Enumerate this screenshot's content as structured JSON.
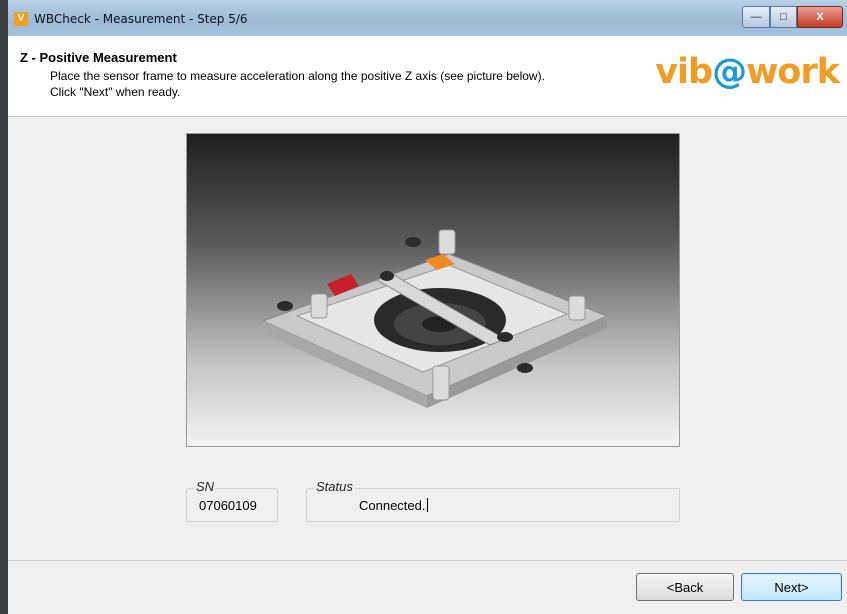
{
  "window": {
    "title": "WBCheck - Measurement - Step 5/6",
    "app_icon": "wbcheck-app-icon",
    "controls": {
      "minimize": "—",
      "maximize": "□",
      "close": "X"
    }
  },
  "header": {
    "title": "Z - Positive Measurement",
    "instruction_line1": "Place the sensor frame to measure acceleration along the positive Z axis (see picture below).",
    "instruction_line2": "Click \"Next\" when ready.",
    "logo_part1": "vib",
    "logo_part2": "@",
    "logo_part3": "work"
  },
  "image": {
    "subject": "sensor-frame-positive-z-orientation"
  },
  "fields": {
    "sn_label": "SN",
    "sn_value": "07060109",
    "status_label": "Status",
    "status_value": "Connected."
  },
  "buttons": {
    "back": "<Back",
    "next": "Next>"
  },
  "colors": {
    "logo_orange": "#f39c24",
    "logo_blue": "#1a9bd7",
    "primary_button": "#bee6fd"
  }
}
